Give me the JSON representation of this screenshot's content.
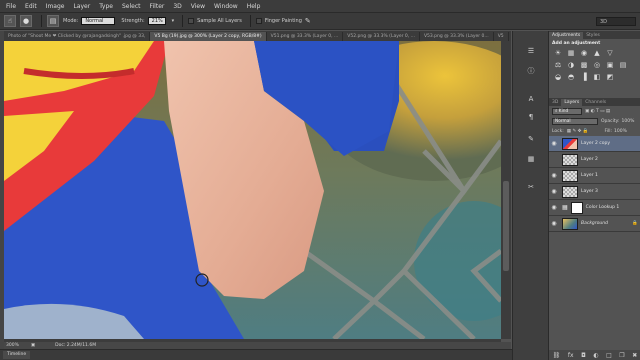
{
  "menu": [
    "File",
    "Edit",
    "Image",
    "Layer",
    "Type",
    "Select",
    "Filter",
    "3D",
    "View",
    "Window",
    "Help"
  ],
  "options": {
    "mode_label": "Mode:",
    "mode_value": "Normal",
    "strength_label": "Strength:",
    "strength_value": "21%",
    "sample_all_layers": "Sample All Layers",
    "finger_painting": "Finger Painting",
    "workspace": "3D"
  },
  "doc_tabs": [
    "Photo of \"Shoot Me ❤ Clicked by @rajangadsingh\" .jpg @ 33,",
    "V5 Bg (19).jpg @ 300% (Layer 2 copy, RGB/8#)",
    "V51.png @ 33.3% (Layer 0, ...",
    "V52.png @ 33.3% (Layer 0, ...",
    "V53.png @ 33.3% (Layer 0...",
    "V5"
  ],
  "status": {
    "zoom": "300%",
    "doc": "Doc: 2.24M/11.6M"
  },
  "timeline_label": "Timeline",
  "right_panel": {
    "tabs": [
      "Adjustments",
      "Styles"
    ],
    "add_adjustment": "Add an adjustment",
    "adj_icons_row1": [
      "☀",
      "▦",
      "◉",
      "▲",
      "▽",
      "◐"
    ],
    "adj_icons_row2": [
      "⚖",
      "◑",
      "▩",
      "◎",
      "▣",
      "▤"
    ],
    "adj_icons_row3": [
      "◒",
      "◓",
      "▐",
      "◧",
      "◩",
      "▥"
    ]
  },
  "layers": {
    "tabs": [
      "3D",
      "Layers",
      "Channels"
    ],
    "kind": "Kind",
    "blend": "Normal",
    "opacity_label": "Opacity:",
    "opacity_value": "100%",
    "lock_label": "Lock:",
    "fill_label": "Fill:",
    "fill_value": "100%",
    "items": [
      {
        "name": "Layer 2 copy",
        "visible": true
      },
      {
        "name": "Layer 2",
        "visible": false
      },
      {
        "name": "Layer 1",
        "visible": true
      },
      {
        "name": "Layer 3",
        "visible": true
      },
      {
        "name": "Color Lookup 1",
        "visible": true
      },
      {
        "name": "Background",
        "visible": true
      }
    ],
    "footer_icons": [
      "⛓",
      "fx",
      "◘",
      "◐",
      "□",
      "❐",
      "✖"
    ]
  }
}
